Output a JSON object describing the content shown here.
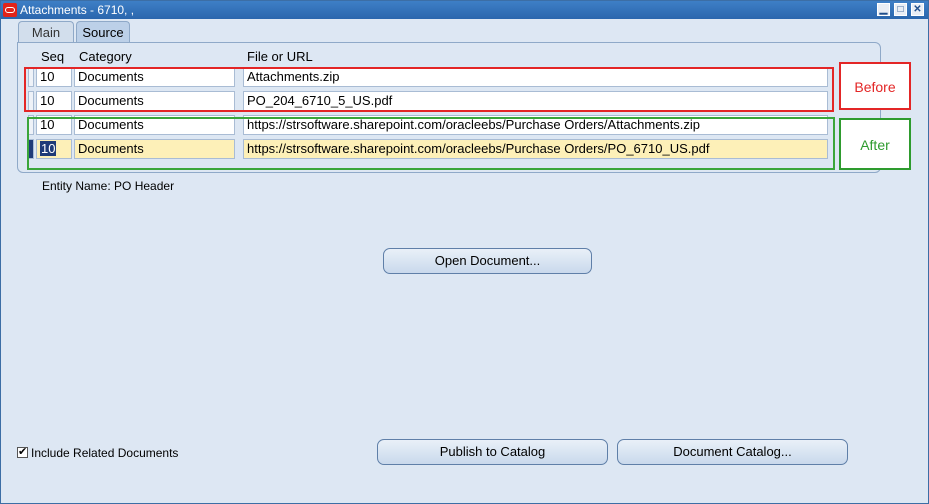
{
  "window": {
    "title": "Attachments - 6710, ,",
    "minimize_glyph": "▁",
    "maximize_glyph": "□",
    "close_glyph": "✕"
  },
  "tabs": [
    {
      "label": "Main",
      "selected": false
    },
    {
      "label": "Source",
      "selected": true
    }
  ],
  "table": {
    "headers": {
      "seq": "Seq",
      "category": "Category",
      "file": "File or URL"
    },
    "rows": [
      {
        "seq": "10",
        "category": "Documents",
        "file": "Attachments.zip"
      },
      {
        "seq": "10",
        "category": "Documents",
        "file": "PO_204_6710_5_US.pdf"
      },
      {
        "seq": "10",
        "category": "Documents",
        "file": "https://strsoftware.sharepoint.com/oracleebs/Purchase Orders/Attachments.zip"
      },
      {
        "seq": "10",
        "category": "Documents",
        "file": "https://strsoftware.sharepoint.com/oracleebs/Purchase Orders/PO_6710_US.pdf"
      }
    ]
  },
  "callouts": {
    "before": "Before",
    "after": "After",
    "colors": {
      "before": "#e32626",
      "after": "#2e9b2e"
    }
  },
  "entity": {
    "label": "Entity Name:",
    "value": "PO Header"
  },
  "buttons": {
    "open_document": "Open Document...",
    "publish_to_catalog": "Publish to Catalog",
    "document_catalog": "Document Catalog..."
  },
  "include_related": {
    "label": "Include Related Documents",
    "checked": true,
    "check_glyph": "✔"
  }
}
